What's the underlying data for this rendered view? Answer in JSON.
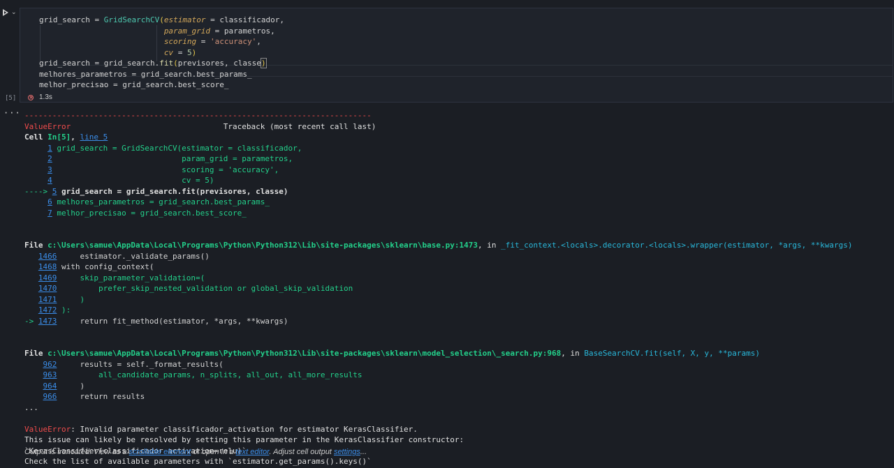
{
  "cell": {
    "execution_count": "[5]",
    "duration": "1.3s",
    "code_lines": [
      "grid_search = GridSearchCV(estimator = classificador,",
      "                           param_grid = parametros,",
      "                           scoring = 'accuracy',",
      "                           cv = 5)",
      "grid_search = grid_search.fit(previsores, classe)",
      "melhores_parametros = grid_search.best_params_",
      "melhor_precisao = grid_search.best_score_"
    ]
  },
  "output": {
    "separator": "---------------------------------------------------------------------------",
    "error_name": "ValueError",
    "traceback_header": "Traceback (most recent call last)",
    "cell_ref_prefix": "Cell ",
    "cell_ref_in": "In[5]",
    "cell_ref_sep": ", ",
    "cell_ref_line": "line 5",
    "frame1": [
      {
        "arrow": "     ",
        "num": "1",
        "code": "grid_search = GridSearchCV(estimator = classificador,",
        "current": false
      },
      {
        "arrow": "     ",
        "num": "2",
        "code": "                           param_grid = parametros,",
        "current": false
      },
      {
        "arrow": "     ",
        "num": "3",
        "code": "                           scoring = 'accuracy',",
        "current": false
      },
      {
        "arrow": "     ",
        "num": "4",
        "code": "                           cv = 5)",
        "current": false
      },
      {
        "arrow": "----> ",
        "num": "5",
        "code": "grid_search = grid_search.fit(previsores, classe)",
        "current": true
      },
      {
        "arrow": "     ",
        "num": "6",
        "code": "melhores_parametros = grid_search.best_params_",
        "current": false
      },
      {
        "arrow": "     ",
        "num": "7",
        "code": "melhor_precisao = grid_search.best_score_",
        "current": false
      }
    ],
    "file1_prefix": "File ",
    "file1_path": "c:\\Users\\samue\\AppData\\Local\\Programs\\Python\\Python312\\Lib\\site-packages\\sklearn\\base.py:1473",
    "file1_in": ", in ",
    "file1_func": "_fit_context.<locals>.decorator.<locals>.wrapper",
    "file1_args": "(estimator, *args, **kwargs)",
    "frame2": [
      {
        "arrow": "   ",
        "num": "1466",
        "code": "    estimator._validate_params()"
      },
      {
        "arrow": "   ",
        "num": "1468",
        "code": "with config_context("
      },
      {
        "arrow": "   ",
        "num": "1469",
        "code": "    skip_parameter_validation=("
      },
      {
        "arrow": "   ",
        "num": "1470",
        "code": "        prefer_skip_nested_validation or global_skip_validation"
      },
      {
        "arrow": "   ",
        "num": "1471",
        "code": "    )"
      },
      {
        "arrow": "   ",
        "num": "1472",
        "code": "):"
      },
      {
        "arrow": "-> ",
        "num": "1473",
        "code": "    return fit_method(estimator, *args, **kwargs)"
      }
    ],
    "file2_prefix": "File ",
    "file2_path": "c:\\Users\\samue\\AppData\\Local\\Programs\\Python\\Python312\\Lib\\site-packages\\sklearn\\model_selection\\_search.py:968",
    "file2_in": ", in ",
    "file2_func": "BaseSearchCV.fit",
    "file2_args": "(self, X, y, **params)",
    "frame3": [
      {
        "arrow": "    ",
        "num": "962",
        "code": "    results = self._format_results("
      },
      {
        "arrow": "    ",
        "num": "963",
        "code": "        all_candidate_params, n_splits, all_out, all_more_results"
      },
      {
        "arrow": "    ",
        "num": "964",
        "code": "    )"
      },
      {
        "arrow": "    ",
        "num": "966",
        "code": "    return results"
      }
    ],
    "ellipsis": "...",
    "final_error_name": "ValueError",
    "final_error_msg": ": Invalid parameter classificador_activation for estimator KerasClassifier.",
    "message_lines": [
      "This issue can likely be resolved by setting this parameter in the KerasClassifier constructor:",
      "`KerasClassifier(classificador_activation=relu)`",
      "Check the list of available parameters with `estimator.get_params().keys()`"
    ]
  },
  "footer": {
    "t1": "Output is truncated. View as a ",
    "link1": "scrollable element",
    "t2": " or open in a ",
    "link2": "text editor",
    "t3": ". Adjust cell output ",
    "link3": "settings",
    "t4": "..."
  }
}
